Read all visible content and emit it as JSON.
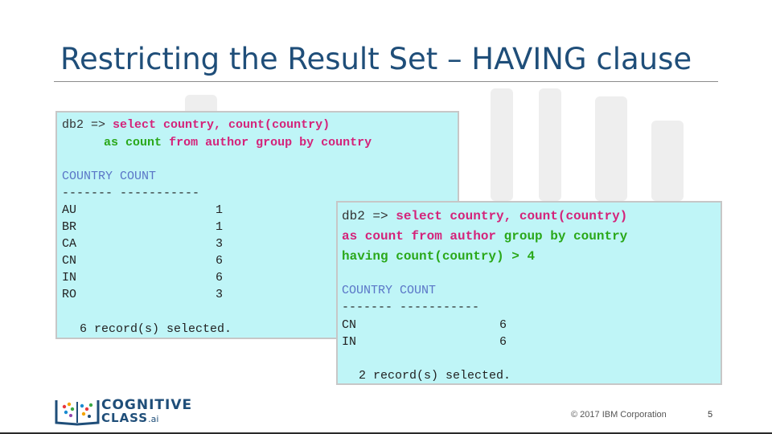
{
  "slide": {
    "title": "Restricting the Result Set – HAVING clause",
    "copyright": "© 2017 IBM Corporation",
    "page_number": "5"
  },
  "logo": {
    "line1": "COGNITIVE",
    "line2": "CLASS",
    "suffix": ".ai"
  },
  "terminal_1": {
    "prompt": "db2 =>",
    "query_line1": "select country, count(country)",
    "query_line2_kw1": "as",
    "query_line2_mid": "count",
    "query_line2_kw2": "from author group by country",
    "header": "COUNTRY COUNT",
    "separator": "------- -----------",
    "rows": [
      {
        "country": "AU",
        "count": "1"
      },
      {
        "country": "BR",
        "count": "1"
      },
      {
        "country": "CA",
        "count": "3"
      },
      {
        "country": "CN",
        "count": "6"
      },
      {
        "country": "IN",
        "count": "6"
      },
      {
        "country": "RO",
        "count": "3"
      }
    ],
    "footer": "6 record(s) selected."
  },
  "terminal_2": {
    "prompt": "db2 =>",
    "query_line1": "select country, count(country)",
    "query_line2_a": "as count from author",
    "query_line2_b": "group by country",
    "query_line3": "having count(country) > 4",
    "header": "COUNTRY COUNT",
    "separator": "------- -----------",
    "rows": [
      {
        "country": "CN",
        "count": "6"
      },
      {
        "country": "IN",
        "count": "6"
      }
    ],
    "footer": "2 record(s) selected."
  }
}
